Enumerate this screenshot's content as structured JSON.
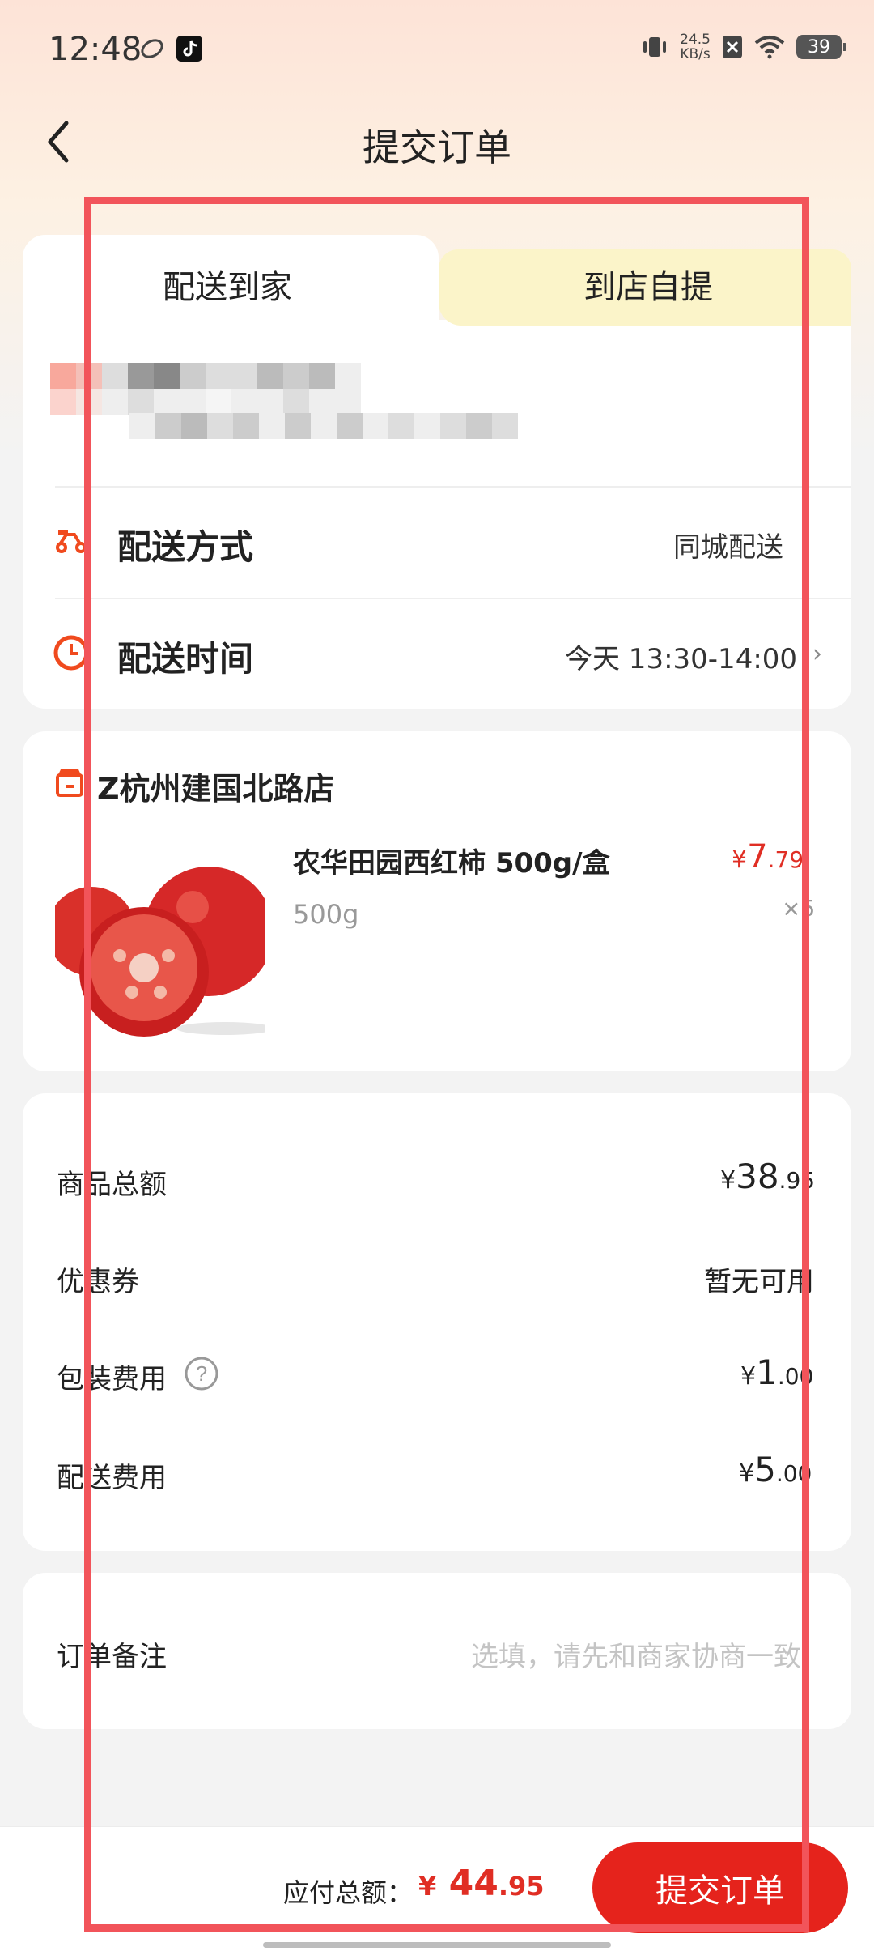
{
  "status_bar": {
    "time": "12:48",
    "net_speed_value": "24.5",
    "net_speed_unit": "KB/s",
    "battery": "39"
  },
  "header": {
    "title": "提交订单"
  },
  "tabs": [
    {
      "label": "配送到家"
    },
    {
      "label": "到店自提"
    }
  ],
  "delivery": {
    "method_label": "配送方式",
    "method_value": "同城配送",
    "time_label": "配送时间",
    "time_value": "今天 13:30-14:00"
  },
  "store": {
    "name": "Z杭州建国北路店"
  },
  "product": {
    "name": "农华田园西红柿 500g/盒",
    "spec": "500g",
    "price_symbol": "¥",
    "price_int": "7",
    "price_dec": ".79",
    "qty": "×5"
  },
  "fees": {
    "items": [
      {
        "label": "商品总额",
        "symbol": "¥",
        "int": "38",
        "dec": ".95"
      },
      {
        "label": "优惠券",
        "value": "暂无可用"
      },
      {
        "label": "包装费用",
        "symbol": "¥",
        "int": "1",
        "dec": ".00"
      },
      {
        "label": "配送费用",
        "symbol": "¥",
        "int": "5",
        "dec": ".00"
      }
    ]
  },
  "note": {
    "label": "订单备注",
    "placeholder": "选填，请先和商家协商一致"
  },
  "footer": {
    "total_label": "应付总额：",
    "total_symbol": "¥",
    "total_int": "44",
    "total_dec": ".95",
    "submit_label": "提交订单"
  },
  "colors": {
    "accent": "#e5231c",
    "price": "#e02e24",
    "tab_inactive_bg": "#fbf4c9",
    "overlay": "#f2545a"
  }
}
